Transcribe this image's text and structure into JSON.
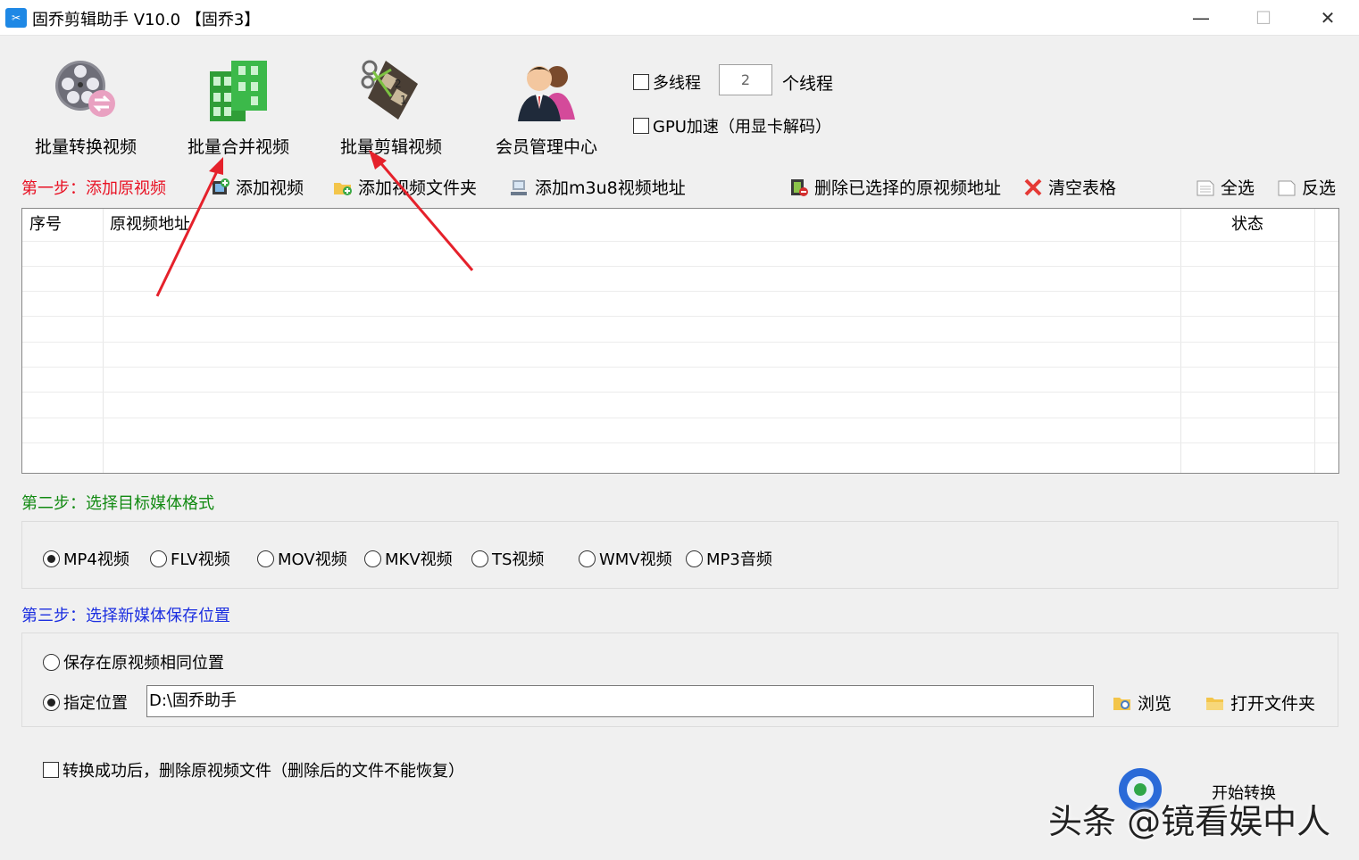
{
  "window": {
    "title": "固乔剪辑助手 V10.0 【固乔3】",
    "minimize_glyph": "—",
    "maximize_glyph": "☐",
    "close_glyph": "✕"
  },
  "toolbar": {
    "convert_label": "批量转换视频",
    "merge_label": "批量合并视频",
    "edit_label": "批量剪辑视频",
    "member_label": "会员管理中心",
    "multithread_label": "多线程",
    "thread_count": "2",
    "thread_unit": "个线程",
    "gpu_label": "GPU加速（用显卡解码）"
  },
  "step1": {
    "title": "第一步：添加原视频",
    "add_video": "添加视频",
    "add_folder": "添加视频文件夹",
    "add_m3u8": "添加m3u8视频地址",
    "delete_selected": "删除已选择的原视频地址",
    "clear_table": "清空表格",
    "select_all": "全选",
    "invert_select": "反选"
  },
  "table": {
    "col_index": "序号",
    "col_path": "原视频地址",
    "col_status": "状态"
  },
  "step2": {
    "title": "第二步：选择目标媒体格式",
    "formats": [
      "MP4视频",
      "FLV视频",
      "MOV视频",
      "MKV视频",
      "TS视频",
      "WMV视频",
      "MP3音频"
    ],
    "selected_index": 0
  },
  "step3": {
    "title": "第三步：选择新媒体保存位置",
    "same_location": "保存在原视频相同位置",
    "custom_location": "指定位置",
    "path_value": "D:\\固乔助手",
    "browse": "浏览",
    "open_folder": "打开文件夹"
  },
  "footer": {
    "delete_after_label": "转换成功后，删除原视频文件（删除后的文件不能恢复）",
    "start_label": "开始转换",
    "watermark": "头条 @镜看娱中人"
  },
  "colors": {
    "accent_red": "#e81123",
    "accent_green": "#128a12",
    "accent_blue": "#1b2ee0",
    "arrow_red": "#e5212b"
  }
}
